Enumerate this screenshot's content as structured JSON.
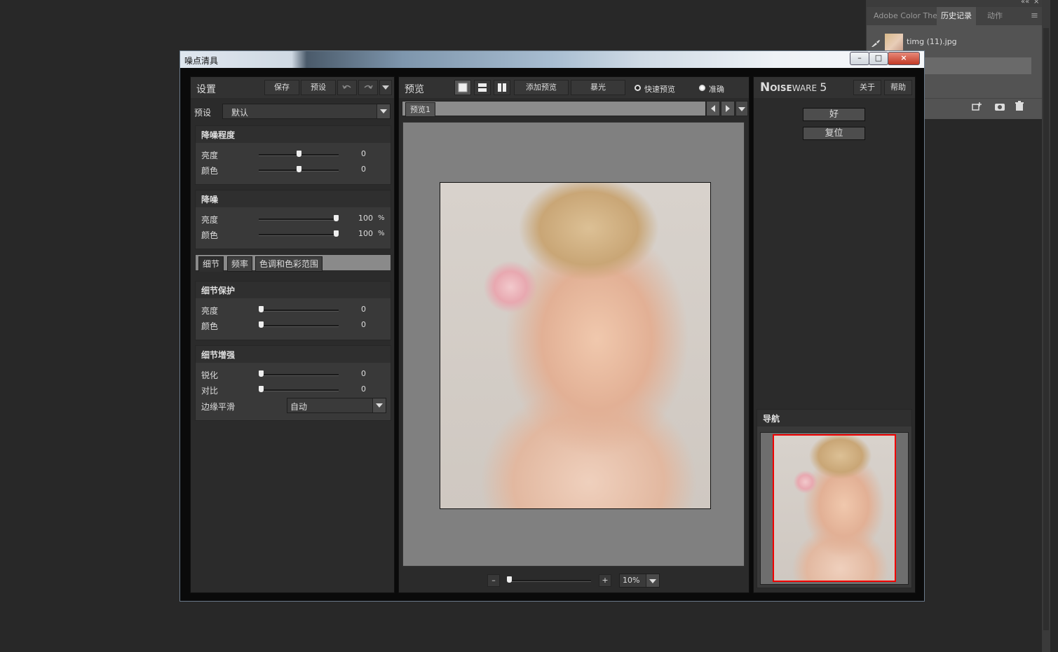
{
  "ps_panel": {
    "top_icons": [
      "««",
      "×"
    ],
    "tabs": [
      {
        "label": "Adobe Color The",
        "active": false
      },
      {
        "label": "历史记录",
        "active": true
      },
      {
        "label": "动作",
        "active": false
      }
    ],
    "menu_icon": "≡",
    "history_item": "timg (11).jpg",
    "footer_icons": [
      "new-snapshot-icon",
      "camera-icon",
      "trash-icon"
    ]
  },
  "dialog": {
    "title": "噪点清具",
    "win_buttons": [
      "–",
      "□",
      "×"
    ]
  },
  "settings": {
    "title": "设置",
    "save": "保存",
    "preset_btn": "预设",
    "preset_label": "预设",
    "preset_value": "默认",
    "level": {
      "title": "降噪程度",
      "rows": [
        {
          "label": "亮度",
          "value": "0",
          "pos": 0.5
        },
        {
          "label": "颜色",
          "value": "0",
          "pos": 0.5
        }
      ]
    },
    "reduction": {
      "title": "降噪",
      "rows": [
        {
          "label": "亮度",
          "value": "100",
          "unit": "%",
          "pos": 1.0
        },
        {
          "label": "颜色",
          "value": "100",
          "unit": "%",
          "pos": 1.0
        }
      ]
    },
    "subtabs": [
      "细节",
      "频率",
      "色调和色彩范围"
    ],
    "detail_protect": {
      "title": "细节保护",
      "rows": [
        {
          "label": "亮度",
          "value": "0",
          "pos": 0
        },
        {
          "label": "颜色",
          "value": "0",
          "pos": 0
        }
      ]
    },
    "detail_enhance": {
      "title": "细节增强",
      "rows": [
        {
          "label": "锐化",
          "value": "0",
          "pos": 0
        },
        {
          "label": "对比",
          "value": "0",
          "pos": 0
        }
      ],
      "edge_label": "边缘平滑",
      "edge_value": "自动"
    }
  },
  "preview": {
    "title": "预览",
    "add_preview": "添加预览",
    "exposure": "暴光",
    "fast_label": "快速预览",
    "accurate_label": "准确",
    "tab": "预览1",
    "zoom_minus": "–",
    "zoom_plus": "+",
    "zoom_value": "10%",
    "zoom_pos": 0.0
  },
  "noiseware": {
    "title_big_n": "N",
    "title_oise": "OISE",
    "title_ware": "WARE",
    "title_ver": "5",
    "about": "关于",
    "help": "帮助",
    "ok": "好",
    "reset": "复位",
    "nav_title": "导航"
  }
}
